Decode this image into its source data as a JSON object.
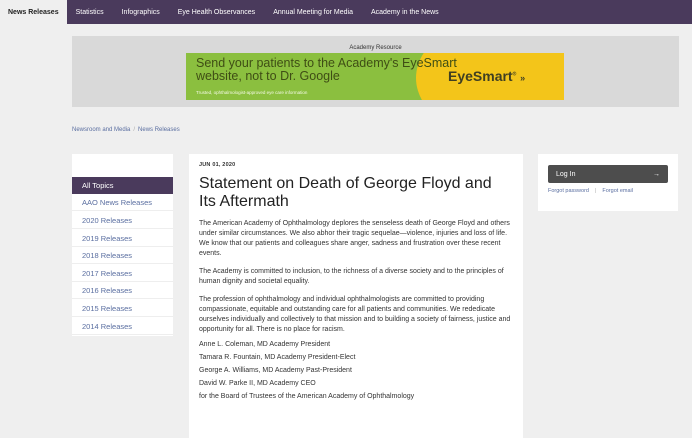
{
  "nav": {
    "tabs": [
      {
        "label": "News Releases",
        "active": true
      },
      {
        "label": "Statistics"
      },
      {
        "label": "Infographics"
      },
      {
        "label": "Eye Health Observances"
      },
      {
        "label": "Annual Meeting for Media"
      },
      {
        "label": "Academy in the News"
      }
    ]
  },
  "resource": {
    "label": "Academy Resource",
    "headline": "Send your patients to the Academy's EyeSmart website, not to Dr. Google",
    "subtext": "Trusted, ophthalmologist-approved eye care information",
    "brand": "EyeSmart",
    "brand_mark": "®",
    "brand_arrow": "»"
  },
  "breadcrumb": {
    "items": [
      "Newsroom and Media",
      "News Releases"
    ],
    "separator": "/"
  },
  "sidebar": {
    "items": [
      {
        "label": "All Topics",
        "active": true
      },
      {
        "label": "AAO News Releases"
      },
      {
        "label": "2020 Releases"
      },
      {
        "label": "2019 Releases"
      },
      {
        "label": "2018 Releases"
      },
      {
        "label": "2017 Releases"
      },
      {
        "label": "2016 Releases"
      },
      {
        "label": "2015 Releases"
      },
      {
        "label": "2014 Releases"
      }
    ]
  },
  "article": {
    "date": "JUN 01, 2020",
    "title": "Statement on Death of George Floyd and Its Aftermath",
    "paragraphs": [
      "The American Academy of Ophthalmology deplores the senseless death of George Floyd and others under similar circumstances. We also abhor their tragic sequelae—violence, injuries and loss of life. We know that our patients and colleagues share anger, sadness and frustration over these recent events.",
      "The Academy is committed to inclusion, to the richness of a diverse society and to the principles of human dignity and societal equality.",
      "The profession of ophthalmology and individual ophthalmologists are committed to providing compassionate, equitable and outstanding care for all patients and communities. We rededicate ourselves individually and collectively to that mission and to building a society of fairness, justice and opportunity for all. There is no place for racism."
    ],
    "signatories": [
      "Anne L. Coleman, MD Academy President",
      "Tamara R. Fountain, MD Academy President-Elect",
      "George A. Williams, MD Academy Past-President",
      "David W. Parke II, MD Academy CEO",
      "for the Board of Trustees of the American Academy of Ophthalmology"
    ]
  },
  "login": {
    "button_label": "Log In",
    "button_arrow": "→",
    "forgot_password": "Forgot password",
    "separator": "|",
    "forgot_email": "Forgot email"
  },
  "colors": {
    "nav_bg": "#4a3a5c",
    "link": "#5a6ea0",
    "banner_green": "#8bbf3f",
    "banner_yellow": "#f3c51a",
    "login_button": "#4d4d4d"
  }
}
